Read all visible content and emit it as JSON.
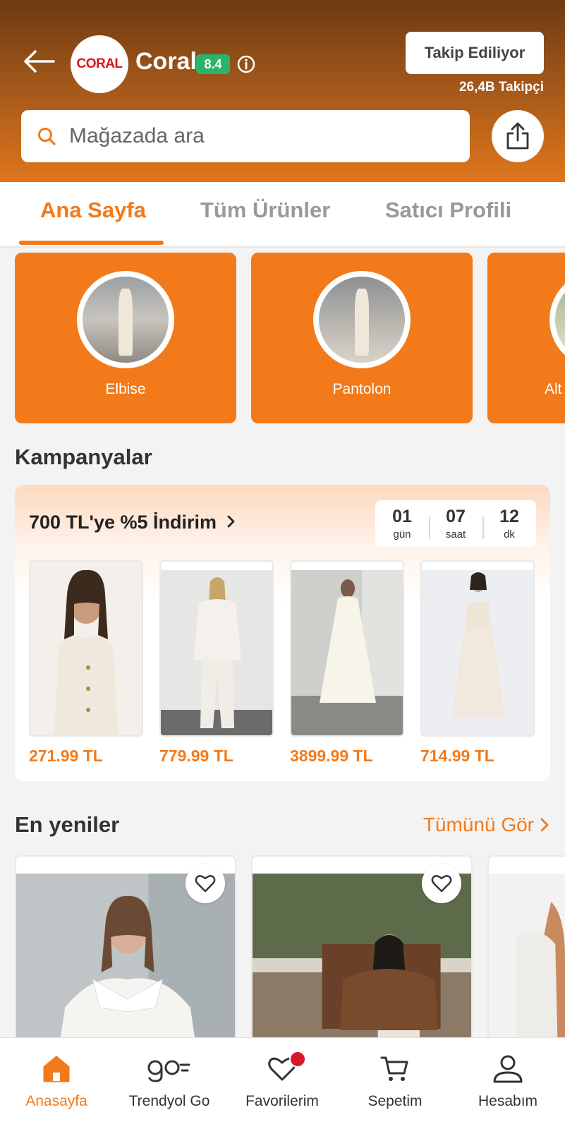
{
  "colors": {
    "accent": "#f27a1a",
    "score": "#2bb36a",
    "header_dark": "#6e3a10"
  },
  "header": {
    "logo_text": "CORAL",
    "store_name": "Coral",
    "score": "8.4",
    "follow_label": "Takip Ediliyor",
    "followers": "26,4B Takipçi",
    "search_placeholder": "Mağazada ara"
  },
  "tabs": [
    {
      "label": "Ana Sayfa",
      "active": true
    },
    {
      "label": "Tüm Ürünler",
      "active": false
    },
    {
      "label": "Satıcı Profili",
      "active": false
    }
  ],
  "categories": [
    {
      "label": "Elbise"
    },
    {
      "label": "Pantolon"
    },
    {
      "label": "Alt"
    }
  ],
  "campaigns": {
    "section_title": "Kampanyalar",
    "title": "700 TL'ye %5 İndirim",
    "countdown": [
      {
        "value": "01",
        "unit": "gün"
      },
      {
        "value": "07",
        "unit": "saat"
      },
      {
        "value": "12",
        "unit": "dk"
      }
    ],
    "products": [
      {
        "price": "271.99 TL"
      },
      {
        "price": "779.99 TL"
      },
      {
        "price": "3899.99 TL"
      },
      {
        "price": "714.99 TL"
      }
    ]
  },
  "new_arrivals": {
    "section_title": "En yeniler",
    "see_all": "Tümünü Gör"
  },
  "bottom_nav": [
    {
      "label": "Anasayfa",
      "icon": "home-icon",
      "active": true
    },
    {
      "label": "Trendyol Go",
      "icon": "go-icon",
      "active": false
    },
    {
      "label": "Favorilerim",
      "icon": "heart-icon",
      "active": false
    },
    {
      "label": "Sepetim",
      "icon": "cart-icon",
      "active": false
    },
    {
      "label": "Hesabım",
      "icon": "user-icon",
      "active": false
    }
  ]
}
